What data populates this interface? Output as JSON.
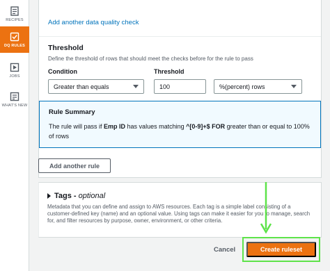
{
  "sidebar": {
    "items": [
      {
        "label": "RECIPES",
        "icon": "recipes-icon",
        "active": false
      },
      {
        "label": "DQ RULES",
        "icon": "dq-rules-icon",
        "active": true
      },
      {
        "label": "JOBS",
        "icon": "jobs-icon",
        "active": false
      },
      {
        "label": "WHAT'S NEW",
        "icon": "whats-new-icon",
        "active": false
      }
    ]
  },
  "main": {
    "add_check_link": "Add another data quality check",
    "threshold": {
      "title": "Threshold",
      "description": "Define the threshold of rows that should meet the checks before for the rule to pass",
      "condition_label": "Condition",
      "condition_value": "Greater than equals",
      "threshold_label": "Threshold",
      "threshold_value": "100",
      "unit_value": "%(percent) rows"
    },
    "summary": {
      "title": "Rule Summary",
      "text_prefix": "The rule will pass if ",
      "column": "Emp ID",
      "text_mid": " has values matching ",
      "pattern": "^[0-9]+$",
      "keyword": "FOR",
      "text_suffix": " greater than or equal to 100% of rows"
    },
    "add_rule_button": "Add another rule"
  },
  "tags": {
    "title": "Tags - ",
    "optional": "optional",
    "description": "Metadata that you can define and assign to AWS resources. Each tag is a simple label consisting of a customer-defined key (name) and an optional value. Using tags can make it easier for you to manage, search for, and filter resources by purpose, owner, environment, or other criteria."
  },
  "footer": {
    "cancel_label": "Cancel",
    "create_label": "Create ruleset"
  },
  "colors": {
    "accent": "#ec7211",
    "link": "#0073bb",
    "highlight": "#5ee34a",
    "summary_bg": "#f1faff"
  }
}
